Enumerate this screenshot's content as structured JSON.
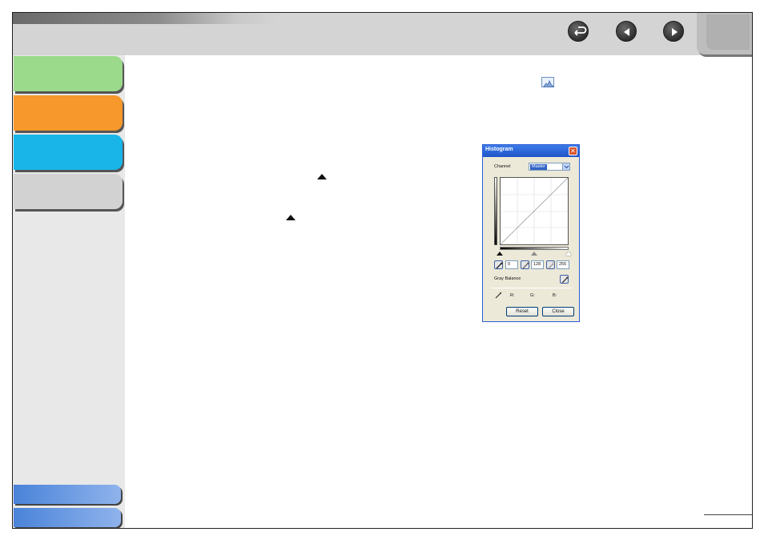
{
  "nav": {
    "return_label": "Return",
    "prev_label": "Previous",
    "next_label": "Next"
  },
  "dialog": {
    "title": "Histogram",
    "close_glyph": "✕",
    "channel_label": "Channel",
    "channel_value": "Master",
    "black_value": "0",
    "gray_value": "128",
    "white_value": "255",
    "gray_balance_label": "Gray Balance",
    "r_label": "R:",
    "g_label": "G:",
    "b_label": "B:",
    "reset_label": "Reset",
    "close_label": "Close"
  },
  "colors": {
    "tab_green": "#9bd98b",
    "tab_orange": "#f6982b",
    "tab_blue": "#19b5e8",
    "tab_gray": "#d2d2d2",
    "title_bar": "#1f55c9"
  }
}
